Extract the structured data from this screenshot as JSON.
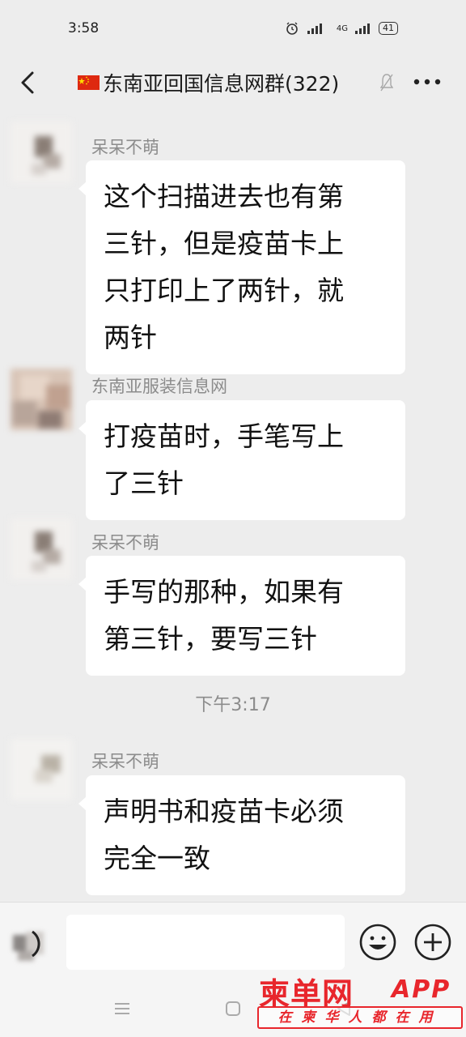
{
  "status_bar": {
    "time": "3:58",
    "network": "4G",
    "battery": "41"
  },
  "header": {
    "title": "东南亚回国信息网群(322)"
  },
  "messages": [
    {
      "sender": "呆呆不萌",
      "text_lines": [
        "这个扫描进去也有第",
        "三针，但是疫苗卡上",
        "只打印上了两针，就",
        "两针"
      ]
    },
    {
      "sender": "东南亚服装信息网",
      "text_lines": [
        "打疫苗时，手笔写上",
        "了三针"
      ]
    },
    {
      "sender": "呆呆不萌",
      "text_lines": [
        "手写的那种，如果有",
        "第三针，要写三针"
      ]
    },
    {
      "sender": "呆呆不萌",
      "text_lines": [
        "声明书和疫苗卡必须",
        "完全一致"
      ]
    }
  ],
  "time_divider": "下午3:17",
  "watermark": {
    "main": "柬单网",
    "app": "APP",
    "slogan": "在柬华人都在用"
  },
  "colors": {
    "background": "#ededed",
    "bubble": "#ffffff",
    "watermark": "#e8262c",
    "meta_text": "#8c8c8c"
  },
  "icons": [
    "back-icon",
    "china-flag-icon",
    "mute-icon",
    "more-icon",
    "voice-icon",
    "emoji-icon",
    "plus-icon"
  ]
}
